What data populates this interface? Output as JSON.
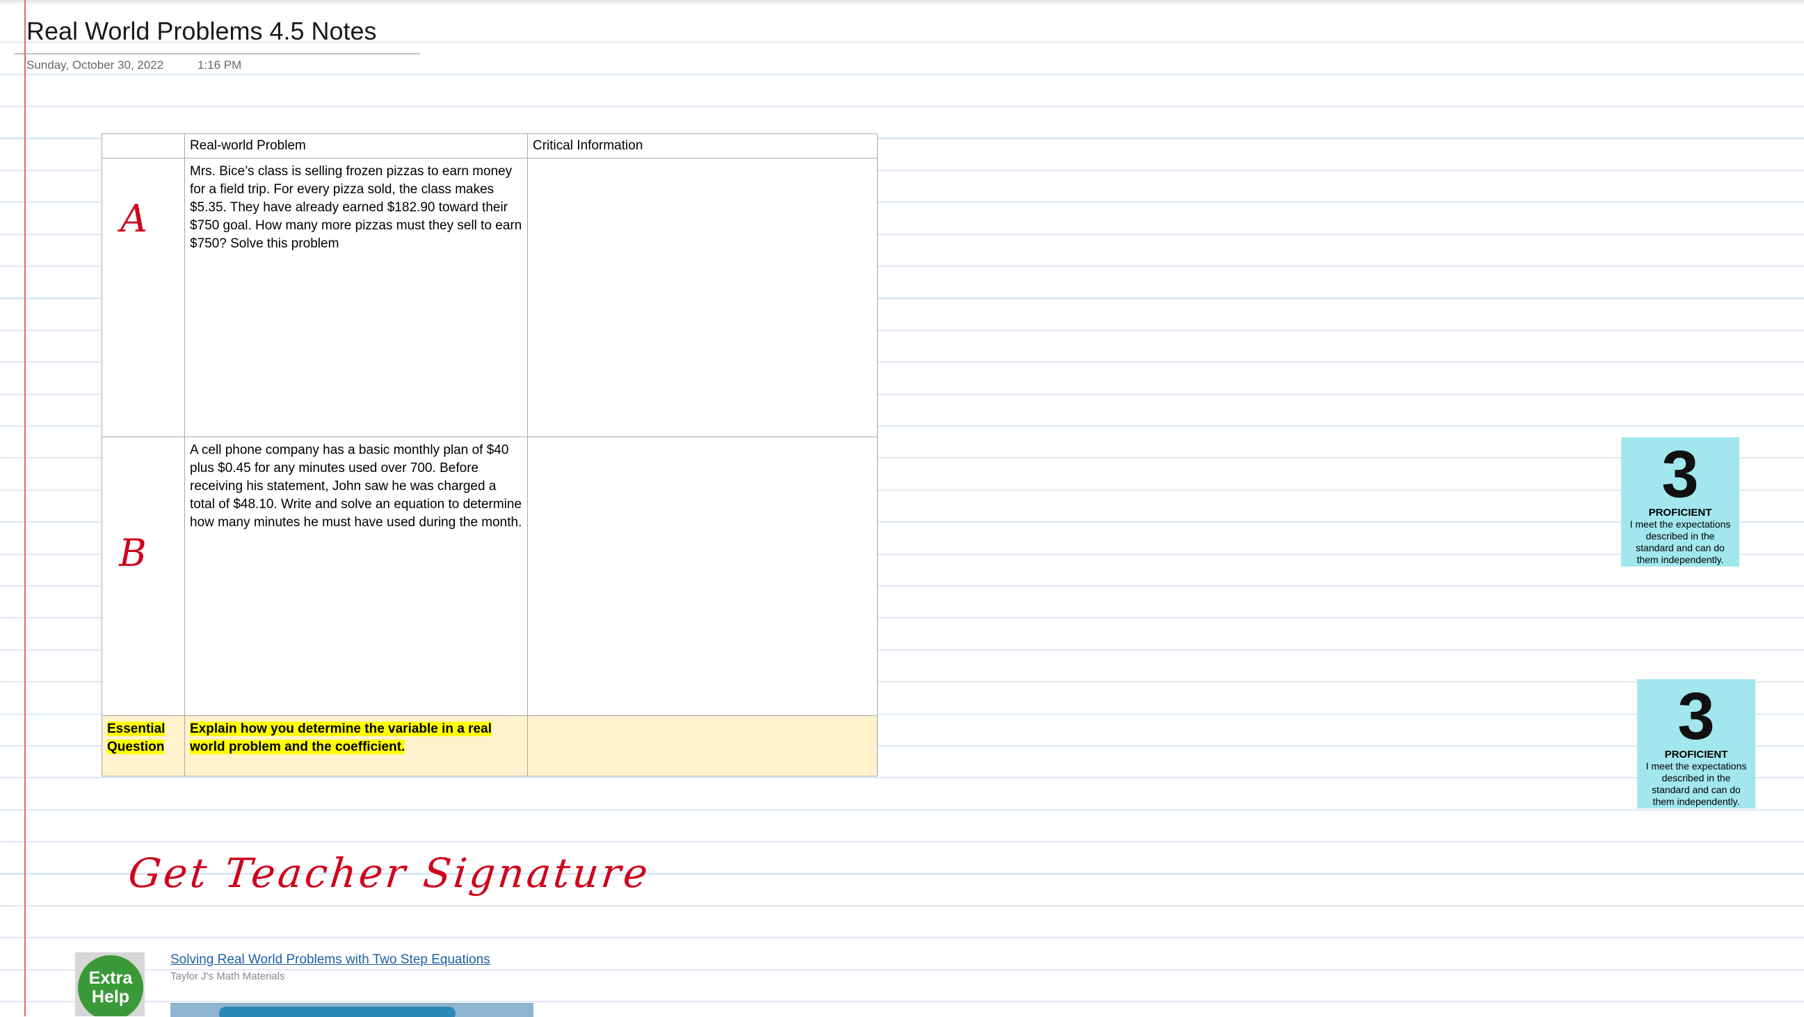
{
  "page": {
    "title": "Real World Problems 4.5 Notes",
    "date": "Sunday, October 30, 2022",
    "time": "1:16 PM"
  },
  "table": {
    "headers": [
      "",
      "Real-world Problem",
      "Critical Information"
    ],
    "rows": [
      {
        "label": "A",
        "problem": "Mrs. Bice’s class is selling frozen pizzas to earn money for a field trip. For every pizza sold, the class makes $5.35. They have already earned $182.90 toward their $750 goal. How many more pizzas must they sell to earn $750? Solve this problem",
        "critical": ""
      },
      {
        "label": "B",
        "problem": "A cell phone company has a basic monthly plan of $40 plus $0.45 for any minutes used over 700. Before receiving his statement, John saw he was charged a total of $48.10. Write and solve an equation to determine how many minutes he must have used during the month.",
        "critical": ""
      }
    ],
    "essential": {
      "label_line1": "Essential",
      "label_line2": "Question",
      "question_line1": "Explain how you determine the variable in a real",
      "question_line2": "world problem and the coefficient.",
      "answer": ""
    }
  },
  "badges": [
    {
      "number": "3",
      "level": "PROFICIENT",
      "desc_lines": [
        "I meet the expectations",
        "described in the",
        "standard and can do",
        "them independently."
      ]
    },
    {
      "number": "3",
      "level": "PROFICIENT",
      "desc_lines": [
        "I meet the expectations",
        "described in the",
        "standard and can do",
        "them independently."
      ]
    }
  ],
  "signature_note": "Get Teacher Signature",
  "extra_help": {
    "thumb_line1": "Extra",
    "thumb_line2": "Help",
    "link_title": "Solving Real World Problems with Two Step Equations",
    "source": "Taylor J's Math Materials"
  },
  "colors": {
    "margin_line": "#e06767",
    "rule_lines": "#d9e6f2",
    "ink_red": "#d0021b",
    "highlight": "#ffff00",
    "essential_row": "#fff2cc",
    "badge": "#a2e7ee",
    "link": "#1f5fa8",
    "help_circle": "#3a9a3a"
  }
}
